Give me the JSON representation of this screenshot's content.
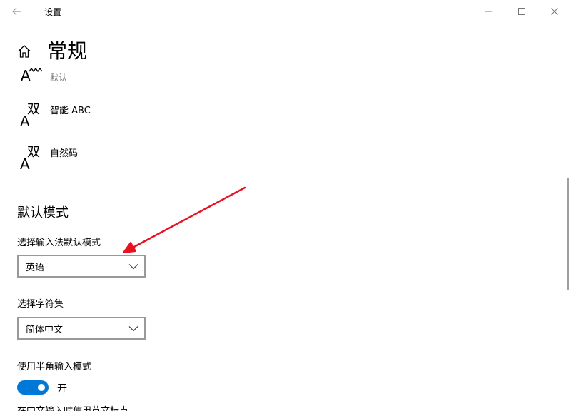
{
  "window": {
    "title": "设置",
    "back_icon": "back-arrow-icon",
    "minimize_icon": "minimize-icon",
    "maximize_icon": "maximize-icon",
    "close_icon": "close-icon"
  },
  "header": {
    "home_icon": "home-icon",
    "title": "常规"
  },
  "ime_list": [
    {
      "icon": "ime-default-icon",
      "name": "",
      "sub": "默认"
    },
    {
      "icon": "ime-double-pinyin-icon",
      "glyph_a": "A",
      "glyph_zh": "双",
      "name": "智能 ABC"
    },
    {
      "icon": "ime-double-pinyin-icon",
      "glyph_a": "A",
      "glyph_zh": "双",
      "name": "自然码"
    }
  ],
  "default_mode": {
    "heading": "默认模式",
    "ime_mode_label": "选择输入法默认模式",
    "ime_mode_value": "英语",
    "charset_label": "选择字符集",
    "charset_value": "简体中文",
    "halfwidth_label": "使用半角输入模式",
    "halfwidth_state": "开",
    "next_label_partial": "在中文输入时使用英文标点"
  },
  "colors": {
    "accent": "#0078d7",
    "annotation": "#e81123",
    "border": "#999999",
    "muted_text": "#767676"
  }
}
